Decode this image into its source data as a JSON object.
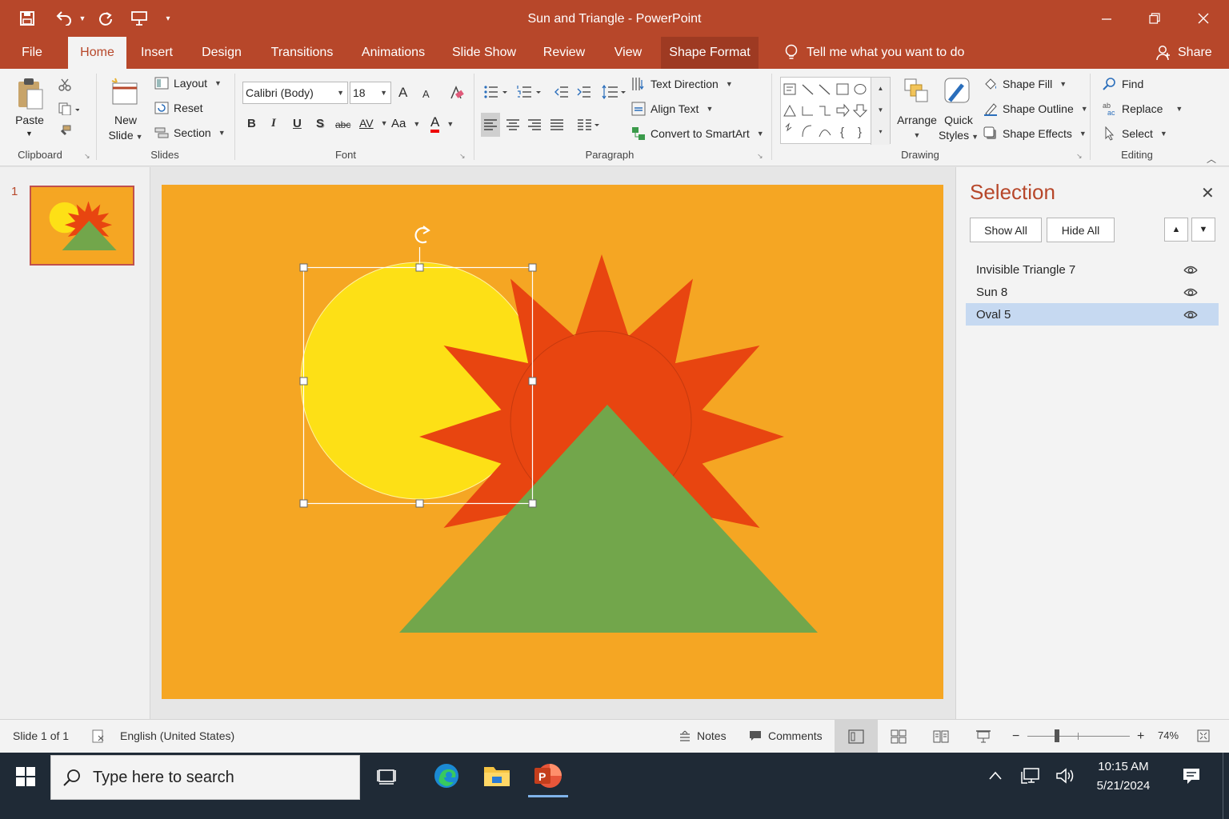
{
  "window": {
    "title": "Sun and Triangle - PowerPoint",
    "controls": [
      "minimize-icon",
      "restore-icon",
      "close-icon"
    ]
  },
  "quick_access": [
    "save-icon",
    "undo-icon",
    "redo-icon",
    "present-icon",
    "customize-icon"
  ],
  "tabs": [
    {
      "label": "File"
    },
    {
      "label": "Home"
    },
    {
      "label": "Insert"
    },
    {
      "label": "Design"
    },
    {
      "label": "Transitions"
    },
    {
      "label": "Animations"
    },
    {
      "label": "Slide Show"
    },
    {
      "label": "Review"
    },
    {
      "label": "View"
    },
    {
      "label": "Shape Format"
    }
  ],
  "active_tab": "Home",
  "tell_me": "Tell me what you want to do",
  "share": "Share",
  "ribbon": {
    "clipboard": {
      "label": "Clipboard",
      "paste": "Paste"
    },
    "slides": {
      "label": "Slides",
      "new_slide_1": "New",
      "new_slide_2": "Slide",
      "layout": "Layout",
      "reset": "Reset",
      "section": "Section"
    },
    "font": {
      "label": "Font",
      "family": "Calibri (Body)",
      "size": "18",
      "change_case": "Aa",
      "bold": "B",
      "italic": "I",
      "underline": "U",
      "shadow": "S",
      "strike": "abc",
      "spacing": "AV",
      "grow": "A",
      "shrink": "A",
      "color_letter": "A"
    },
    "paragraph": {
      "label": "Paragraph",
      "text_direction": "Text Direction",
      "align_text": "Align Text",
      "convert_smartart": "Convert to SmartArt"
    },
    "drawing": {
      "label": "Drawing",
      "arrange": "Arrange",
      "quick_styles_1": "Quick",
      "quick_styles_2": "Styles",
      "shape_fill": "Shape Fill",
      "shape_outline": "Shape Outline",
      "shape_effects": "Shape Effects"
    },
    "editing": {
      "label": "Editing",
      "find": "Find",
      "replace": "Replace",
      "select": "Select"
    }
  },
  "thumbnails": [
    {
      "number": "1"
    }
  ],
  "slide": {
    "background": "#f5a623",
    "shapes": [
      {
        "name": "Oval 5",
        "color": "#fde016"
      },
      {
        "name": "Sun 8",
        "color": "#e84510"
      },
      {
        "name": "Invisible Triangle 7",
        "color": "#72a64b"
      }
    ]
  },
  "selection_pane": {
    "title": "Selection",
    "show_all": "Show All",
    "hide_all": "Hide All",
    "items": [
      {
        "label": "Invisible Triangle 7",
        "selected": false
      },
      {
        "label": "Sun 8",
        "selected": false
      },
      {
        "label": "Oval 5",
        "selected": true
      }
    ]
  },
  "status": {
    "slide_info": "Slide 1 of 1",
    "language": "English (United States)",
    "notes": "Notes",
    "comments": "Comments",
    "zoom": "74%"
  },
  "taskbar": {
    "search_placeholder": "Type here to search",
    "time": "10:15 AM",
    "date": "5/21/2024"
  },
  "colors": {
    "accent": "#b7472a",
    "selection": "#c6d9f1",
    "taskbar": "#1f2a36"
  }
}
